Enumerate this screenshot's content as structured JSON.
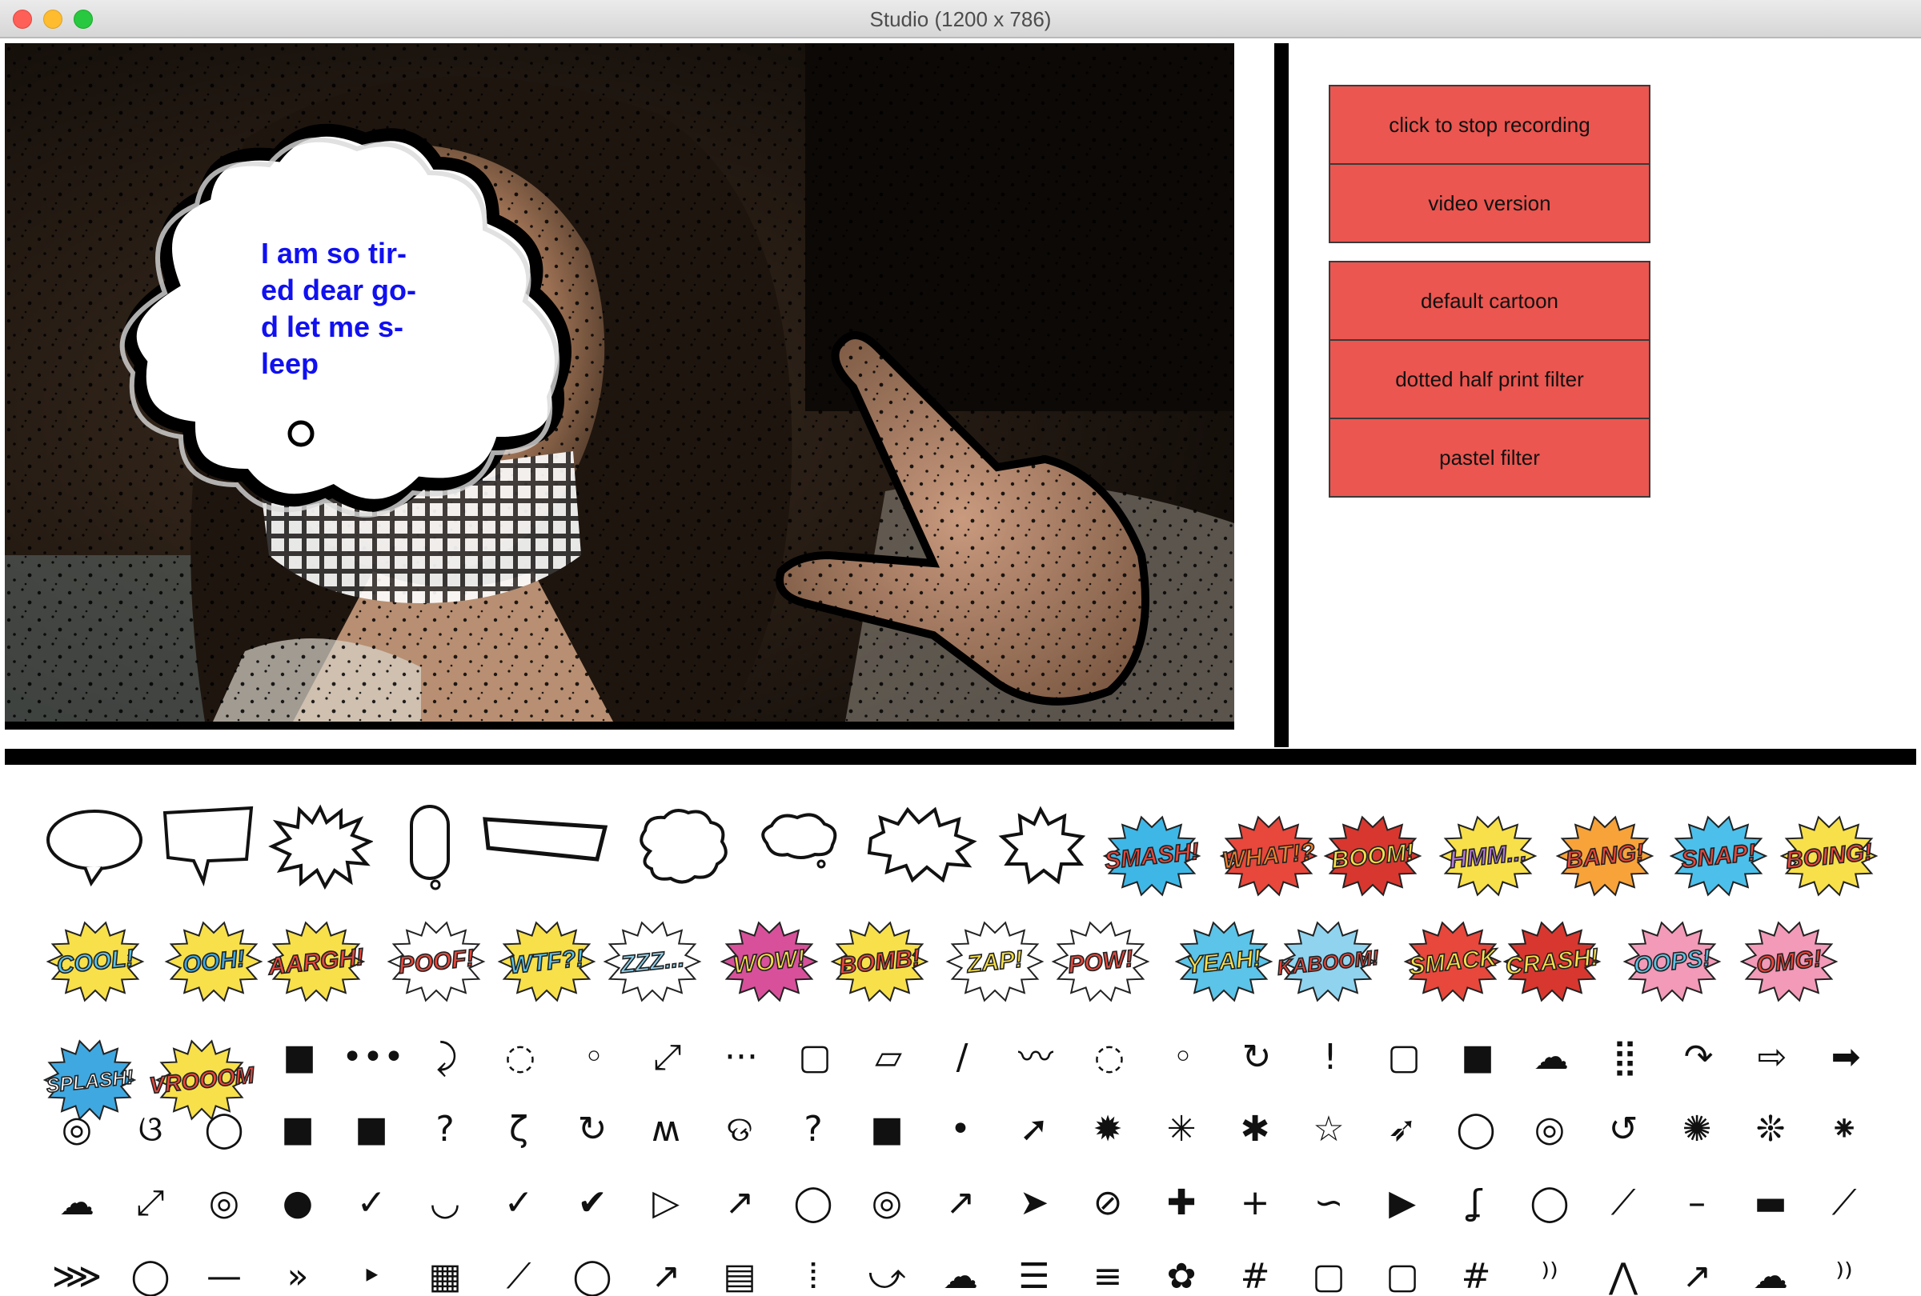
{
  "window": {
    "title": "Studio (1200 x 786)"
  },
  "camera": {
    "bubble_text": "I am so tir-\ned dear go-\nd let me s-\nleep"
  },
  "controls": {
    "recording_buttons": [
      "click to stop recording",
      "video version"
    ],
    "filter_buttons": [
      "default cartoon",
      "dotted half print filter",
      "pastel filter"
    ]
  },
  "palette": {
    "balloon_icons": [
      "round-speech-balloon-icon",
      "square-speech-balloon-icon",
      "spiky-burst-balloon-icon",
      "tall-oval-balloon-icon",
      "wide-rectangle-balloon-icon",
      "cloud-thought-balloon-icon",
      "small-cloud-balloon-icon",
      "wide-burst-balloon-icon",
      "star-burst-balloon-icon"
    ],
    "row1_words": [
      {
        "text": "SMASH!",
        "fill": "#e8473c",
        "burst": "#3fb7e6"
      },
      {
        "text": "WHAT!?",
        "fill": "#f07f2c",
        "burst": "#e8473c"
      },
      {
        "text": "BOOM!",
        "fill": "#f7e04a",
        "burst": "#d8372f"
      },
      {
        "text": "HMM...",
        "fill": "#b07ad8",
        "burst": "#f7e04a"
      },
      {
        "text": "BANG!",
        "fill": "#e8473c",
        "burst": "#f7a33a"
      },
      {
        "text": "SNAP!",
        "fill": "#e8473c",
        "burst": "#4cc0ea"
      },
      {
        "text": "BOING!",
        "fill": "#e8473c",
        "burst": "#f7e04a"
      }
    ],
    "row2_words": [
      {
        "text": "COOL!",
        "fill": "#5bc4e8",
        "burst": "#f7e04a"
      },
      {
        "text": "OOH!",
        "fill": "#3fa8e0",
        "burst": "#f7e04a"
      },
      {
        "text": "AARGH!",
        "fill": "#e8473c",
        "burst": "#f7e04a"
      },
      {
        "text": "POOF!",
        "fill": "#e8473c",
        "burst": "#ffffff"
      },
      {
        "text": "WTF?!",
        "fill": "#5bc4e8",
        "burst": "#f7e04a"
      },
      {
        "text": "ZZZ...",
        "fill": "#8fd3ef",
        "burst": "#ffffff"
      },
      {
        "text": "WOW!",
        "fill": "#f7e04a",
        "burst": "#d8509a"
      },
      {
        "text": "BOMB!",
        "fill": "#e8473c",
        "burst": "#f7e04a"
      },
      {
        "text": "ZAP!",
        "fill": "#f7e04a",
        "burst": "#ffffff"
      },
      {
        "text": "POW!",
        "fill": "#e8473c",
        "burst": "#ffffff"
      },
      {
        "text": "YEAH!",
        "fill": "#f7e04a",
        "burst": "#5bc4e8"
      },
      {
        "text": "KABOOM!",
        "fill": "#e8473c",
        "burst": "#8fd3ef"
      },
      {
        "text": "SMACK",
        "fill": "#f7e04a",
        "burst": "#e8473c"
      },
      {
        "text": "CRASH!",
        "fill": "#f7e04a",
        "burst": "#d8372f"
      },
      {
        "text": "OOPS!",
        "fill": "#5bc4e8",
        "burst": "#f29ab8"
      },
      {
        "text": "OMG!",
        "fill": "#e8473c",
        "burst": "#f29ab8"
      }
    ],
    "row3_words": [
      {
        "text": "SPLASH!",
        "fill": "#ffffff",
        "burst": "#3fa8e0"
      },
      {
        "text": "VROOOM",
        "fill": "#e8473c",
        "burst": "#f7e04a"
      }
    ],
    "row3_icons": [
      "■",
      "•••",
      "⤸",
      "◌",
      "◦",
      "⤢",
      "···",
      "▢",
      "▱",
      "/",
      "〰",
      "◌",
      "◦",
      "↻",
      "!",
      "▢",
      "■",
      "☁",
      "⣿",
      "↷",
      "⇨",
      "➡"
    ],
    "row4_icons": [
      "◎",
      "ଓ",
      "◯",
      "■",
      "■",
      "?",
      "ζ",
      "↻",
      "ʍ",
      "ଡ",
      "?",
      "■",
      "•",
      "➚",
      "✹",
      "✳",
      "✱",
      "☆",
      "➶",
      "◯",
      "◎",
      "↺",
      "✺",
      "❊",
      "⁕"
    ],
    "row5_icons": [
      "☁",
      "⤢",
      "◎",
      "●",
      "✓",
      "◡",
      "✓",
      "✔",
      "▷",
      "↗",
      "◯",
      "◎",
      "↗",
      "➤",
      "⊘",
      "✚",
      "+",
      "∽",
      "▶",
      "ʆ",
      "◯",
      "⟋",
      "–",
      "▬",
      "⟋"
    ],
    "row6_icons": [
      "⋙",
      "◯",
      "—",
      "»",
      "‣",
      "▦",
      "⟋",
      "◯",
      "↗",
      "▤",
      "⦙",
      "⤻",
      "☁",
      "☰",
      "≡",
      "✿",
      "#",
      "▢",
      "▢",
      "#",
      "⁾⁾",
      "⋀",
      "↗",
      "☁",
      "⁾⁾"
    ]
  }
}
